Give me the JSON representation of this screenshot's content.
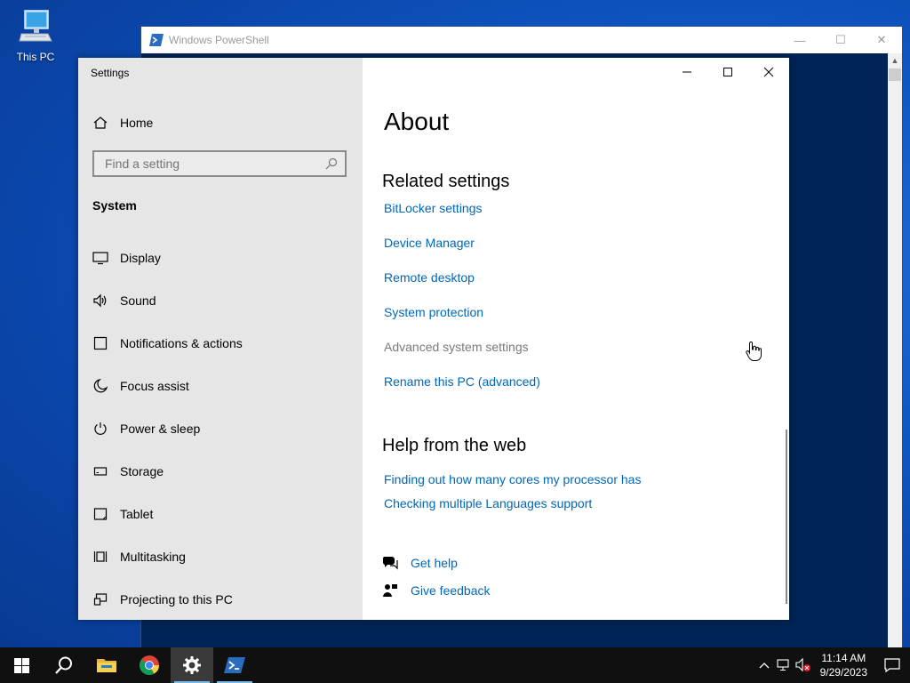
{
  "desktop": {
    "icon_label": "This PC"
  },
  "powershell": {
    "title": "Windows PowerShell"
  },
  "settings": {
    "app_title": "Settings",
    "home_label": "Home",
    "search_placeholder": "Find a setting",
    "section_label": "System",
    "nav_items": [
      {
        "label": "Display",
        "icon": "display-icon"
      },
      {
        "label": "Sound",
        "icon": "speaker-icon"
      },
      {
        "label": "Notifications & actions",
        "icon": "notification-icon"
      },
      {
        "label": "Focus assist",
        "icon": "moon-icon"
      },
      {
        "label": "Power & sleep",
        "icon": "power-icon"
      },
      {
        "label": "Storage",
        "icon": "storage-icon"
      },
      {
        "label": "Tablet",
        "icon": "tablet-icon"
      },
      {
        "label": "Multitasking",
        "icon": "multitasking-icon"
      },
      {
        "label": "Projecting to this PC",
        "icon": "projecting-icon"
      }
    ],
    "page_title": "About",
    "related_heading": "Related settings",
    "related_links": [
      "BitLocker settings",
      "Device Manager",
      "Remote desktop",
      "System protection",
      "Advanced system settings",
      "Rename this PC (advanced)"
    ],
    "help_heading": "Help from the web",
    "help_links": [
      "Finding out how many cores my processor has",
      "Checking multiple Languages support"
    ],
    "get_help": "Get help",
    "give_feedback": "Give feedback"
  },
  "taskbar": {
    "apps": [
      "start-icon",
      "search-icon",
      "file-explorer-icon",
      "chrome-icon",
      "settings-icon",
      "powershell-icon"
    ],
    "time": "11:14 AM",
    "date": "9/29/2023"
  },
  "colors": {
    "link": "#0067b8",
    "nav_bg": "#e6e6e6",
    "taskbar": "#101010",
    "desktop": "#0f58c6"
  }
}
